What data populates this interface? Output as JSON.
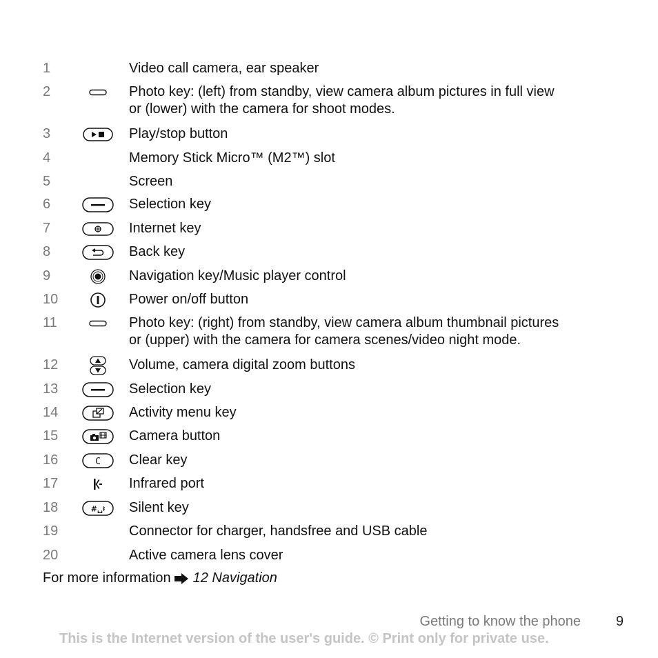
{
  "items": [
    {
      "num": "1",
      "icon": "none",
      "text": "Video call camera, ear speaker"
    },
    {
      "num": "2",
      "icon": "photo-key-icon",
      "text": "Photo key: (left) from standby, view camera album pictures in full view",
      "text2": "or (lower) with the camera for shoot modes."
    },
    {
      "num": "3",
      "icon": "play-stop-icon",
      "text": "Play/stop button"
    },
    {
      "num": "4",
      "icon": "none",
      "text": "Memory Stick Micro™ (M2™) slot"
    },
    {
      "num": "5",
      "icon": "none",
      "text": "Screen"
    },
    {
      "num": "6",
      "icon": "selection-key-icon",
      "text": "Selection key"
    },
    {
      "num": "7",
      "icon": "internet-key-icon",
      "text": "Internet key"
    },
    {
      "num": "8",
      "icon": "back-key-icon",
      "text": "Back key"
    },
    {
      "num": "9",
      "icon": "navigation-key-icon",
      "text": "Navigation key/Music player control"
    },
    {
      "num": "10",
      "icon": "power-icon",
      "text": "Power on/off button"
    },
    {
      "num": "11",
      "icon": "photo-key-icon",
      "text": "Photo key: (right) from standby, view camera album thumbnail pictures",
      "text2": "or (upper) with the camera for camera scenes/video night mode."
    },
    {
      "num": "12",
      "icon": "volume-keys-icon",
      "text": "Volume, camera digital zoom buttons"
    },
    {
      "num": "13",
      "icon": "selection-key-icon",
      "text": "Selection key"
    },
    {
      "num": "14",
      "icon": "activity-menu-key-icon",
      "text": "Activity menu key"
    },
    {
      "num": "15",
      "icon": "camera-button-icon",
      "text": "Camera button"
    },
    {
      "num": "16",
      "icon": "clear-key-icon",
      "text": "Clear key"
    },
    {
      "num": "17",
      "icon": "infrared-port-icon",
      "text": "Infrared port"
    },
    {
      "num": "18",
      "icon": "silent-key-icon",
      "text": "Silent key"
    },
    {
      "num": "19",
      "icon": "none",
      "text": "Connector for charger, handsfree and USB cable"
    },
    {
      "num": "20",
      "icon": "none",
      "text": "Active camera lens cover"
    }
  ],
  "more_info": {
    "prefix": "For more information",
    "reference": "12 Navigation"
  },
  "footer": {
    "section": "Getting to know the phone",
    "page": "9",
    "watermark": "This is the Internet version of the user's guide. © Print only for private use."
  }
}
